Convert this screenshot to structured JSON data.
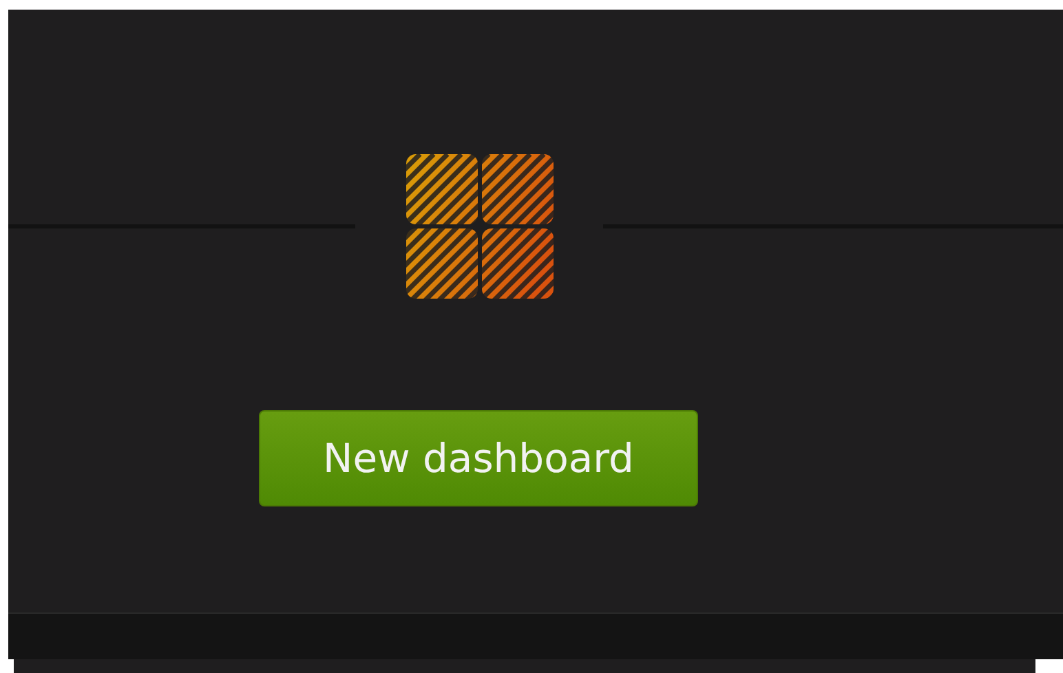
{
  "button": {
    "label": "New dashboard"
  }
}
